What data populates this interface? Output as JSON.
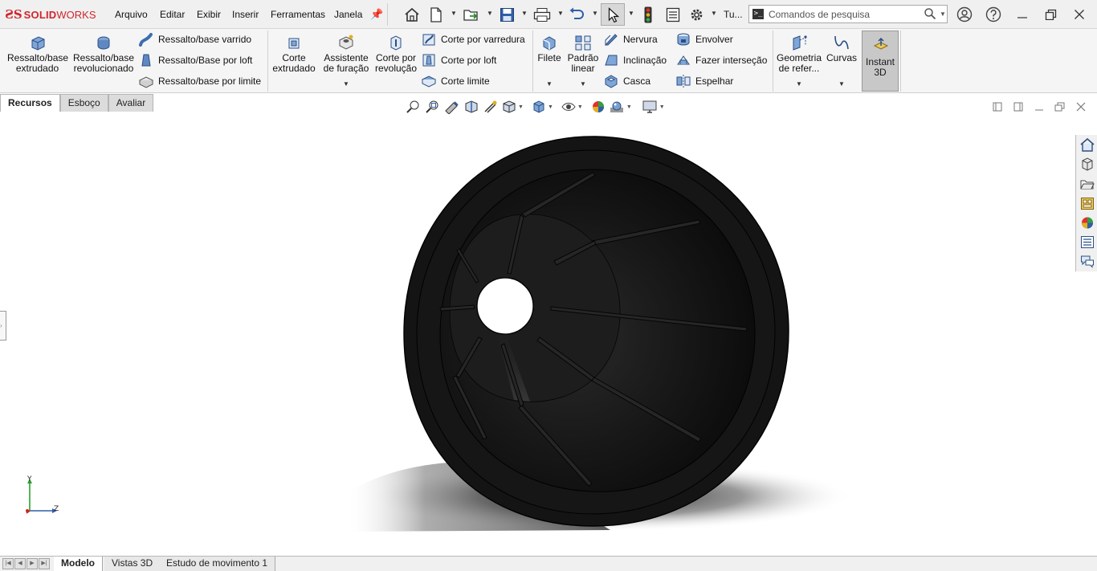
{
  "app": {
    "logo_ds": "ƧS",
    "logo_bold": "SOLID",
    "logo_rest": "WORKS"
  },
  "menu": [
    "Arquivo",
    "Editar",
    "Exibir",
    "Inserir",
    "Ferramentas",
    "Janela"
  ],
  "quick_access": {
    "icons": [
      "home-icon",
      "new-document-icon",
      "open-icon",
      "save-icon",
      "print-icon",
      "undo-icon",
      "select-cursor-icon",
      "rebuild-icon",
      "file-properties-icon",
      "options-gear-icon"
    ],
    "tu_label": "Tu..."
  },
  "search": {
    "placeholder": "Comandos de pesquisa"
  },
  "ribbon": {
    "extruded_boss": "Ressalto/base\nextrudado",
    "revolved_boss": "Ressalto/base\nrevolucionado",
    "swept_boss": "Ressalto/base varrido",
    "lofted_boss": "Ressalto/Base por loft",
    "boundary_boss": "Ressalto/base por limite",
    "extruded_cut": "Corte\nextrudado",
    "hole_wizard": "Assistente\nde furação",
    "revolved_cut": "Corte por\nrevolução",
    "swept_cut": "Corte por varredura",
    "lofted_cut": "Corte por loft",
    "boundary_cut": "Corte limite",
    "fillet": "Filete",
    "linear_pattern": "Padrão\nlinear",
    "rib": "Nervura",
    "draft": "Inclinação",
    "shell": "Casca",
    "wrap": "Envolver",
    "intersect": "Fazer interseção",
    "mirror": "Espelhar",
    "ref_geometry": "Geometria\nde refer...",
    "curves": "Curvas",
    "instant3d": "Instant\n3D"
  },
  "command_tabs": [
    "Recursos",
    "Esboço",
    "Avaliar"
  ],
  "bottom_tabs": [
    "Modelo",
    "Vistas 3D",
    "Estudo de movimento 1"
  ],
  "triad": {
    "y": "Y",
    "z": "Z"
  },
  "colors": {
    "brand": "#d0252c",
    "model": "#141414"
  }
}
